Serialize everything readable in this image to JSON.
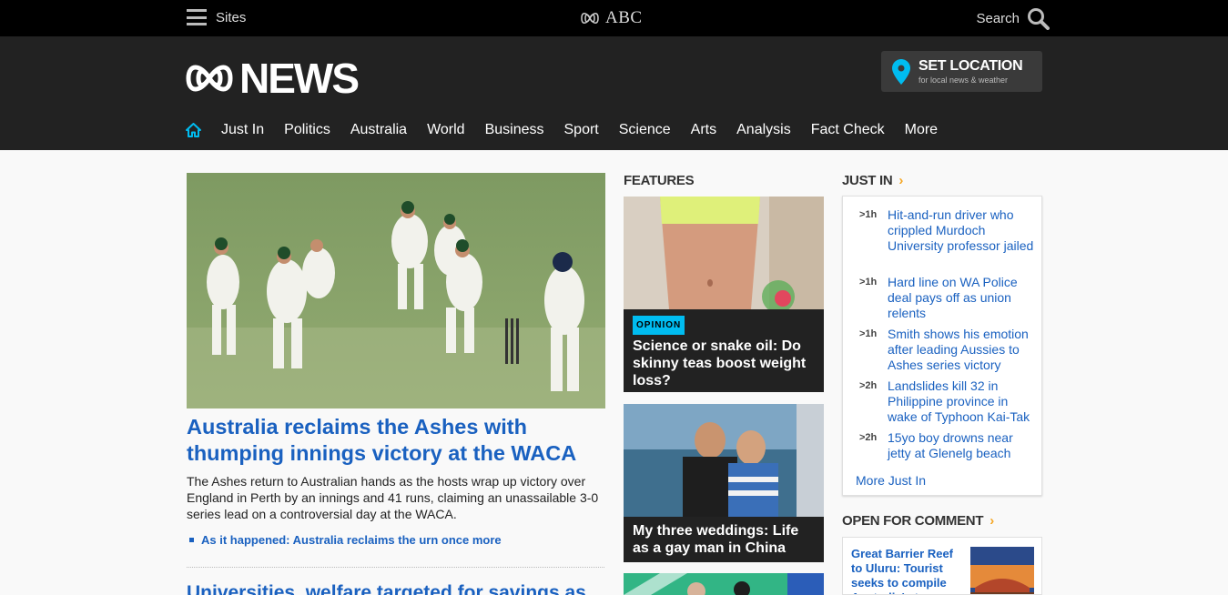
{
  "topbar": {
    "sites_label": "Sites",
    "abc_label": "ABC",
    "search_label": "Search"
  },
  "header": {
    "news_label": "NEWS",
    "set_location_title": "SET LOCATION",
    "set_location_sub": "for local news & weather",
    "nav": [
      "Just In",
      "Politics",
      "Australia",
      "World",
      "Business",
      "Sport",
      "Science",
      "Arts",
      "Analysis",
      "Fact Check",
      "More"
    ]
  },
  "lead": {
    "headline": "Australia reclaims the Ashes with thumping innings victory at the WACA",
    "summary": "The Ashes return to Australian hands as the hosts wrap up victory over England in Perth by an innings and 41 runs, claiming an unassailable 3-0 series lead on a controversial day at the WACA.",
    "related_link": "As it happened: Australia reclaims the urn once more",
    "second_headline": "Universities, welfare targeted for savings as"
  },
  "features": {
    "title": "FEATURES",
    "cards": [
      {
        "badge": "OPINION",
        "headline": "Science or snake oil: Do skinny teas boost weight loss?"
      },
      {
        "headline": "My three weddings: Life as a gay man in China"
      }
    ]
  },
  "just_in": {
    "title": "JUST IN",
    "items": [
      {
        "time": ">1h",
        "title": "Hit-and-run driver who crippled Murdoch University professor jailed"
      },
      {
        "time": ">1h",
        "title": "Hard line on WA Police deal pays off as union relents"
      },
      {
        "time": ">1h",
        "title": "Smith shows his emotion after leading Aussies to Ashes series victory"
      },
      {
        "time": ">2h",
        "title": "Landslides kill 32 in Philippine province in wake of Typhoon Kai-Tak"
      },
      {
        "time": ">2h",
        "title": "15yo boy drowns near jetty at Glenelg beach"
      }
    ],
    "more_label": "More Just In"
  },
  "open_for_comment": {
    "title": "OPEN FOR COMMENT",
    "item_title": "Great Barrier Reef to Uluru: Tourist seeks to compile Australia's top"
  },
  "colors": {
    "link_blue": "#1a61c0",
    "accent_cyan": "#00bcf0",
    "accent_orange": "#f5a623",
    "header_dark": "#222222"
  }
}
